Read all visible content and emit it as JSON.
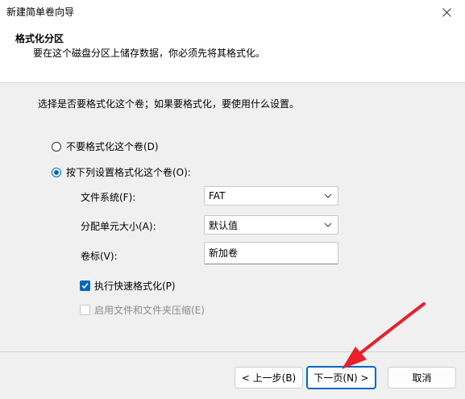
{
  "window": {
    "title": "新建简单卷向导",
    "close_icon": "close-icon"
  },
  "header": {
    "title": "格式化分区",
    "subtitle": "要在这个磁盘分区上储存数据，你必须先将其格式化。"
  },
  "main": {
    "instruction": "选择是否要格式化这个卷；如果要格式化，要使用什么设置。",
    "options": [
      {
        "label": "不要格式化这个卷(D)",
        "selected": false
      },
      {
        "label": "按下列设置格式化这个卷(O):",
        "selected": true
      }
    ],
    "fields": {
      "filesystem": {
        "label": "文件系统(F):",
        "value": "FAT"
      },
      "allocation": {
        "label": "分配单元大小(A):",
        "value": "默认值"
      },
      "volume_label": {
        "label": "卷标(V):",
        "value": "新加卷"
      }
    },
    "checkboxes": [
      {
        "label": "执行快速格式化(P)",
        "checked": true,
        "enabled": true
      },
      {
        "label": "启用文件和文件夹压缩(E)",
        "checked": false,
        "enabled": false
      }
    ]
  },
  "footer": {
    "back_label": "< 上一步(B)",
    "next_label": "下一页(N) >",
    "cancel_label": "取消"
  },
  "colors": {
    "accent": "#0067c0",
    "annotation_arrow": "#e8202a"
  }
}
